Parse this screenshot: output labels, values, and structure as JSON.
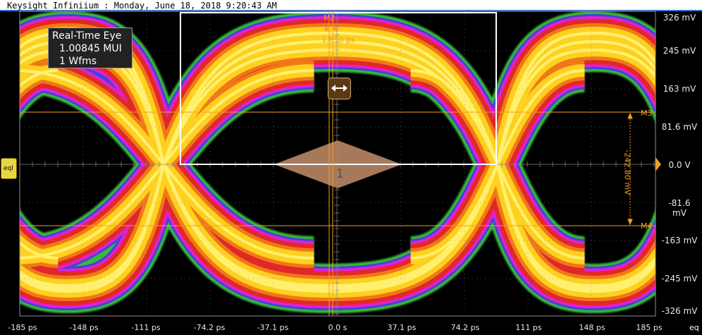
{
  "window": {
    "title": "Keysight Infiniium : Monday, June 18, 2018 9:20:43 AM"
  },
  "info_box": {
    "title": "Real-Time Eye",
    "mui": "1.00845 MUI",
    "wfms": "1 Wfms"
  },
  "y_axis": {
    "labels": [
      "326 mV",
      "245 mV",
      "163 mV",
      "81.6 mV",
      "0.0 V",
      "-81.6 mV",
      "-163 mV",
      "-245 mV",
      "-326 mV"
    ]
  },
  "x_axis": {
    "labels": [
      "-185 ps",
      "-148 ps",
      "-111 ps",
      "-74.2 ps",
      "-37.1 ps",
      "0.0 s",
      "37.1 ps",
      "74.2 ps",
      "111 ps",
      "148 ps",
      "185 ps"
    ]
  },
  "markers": {
    "m2_label": "M2",
    "m2_value": "1.850 ps",
    "m3_label": "M3",
    "m4_label": "M4",
    "delta_v": "-242.80 mV",
    "mask_label": "1"
  },
  "buttons": {
    "left_eql": "eql",
    "right_eq": "eq"
  },
  "colors": {
    "grid": "#8a8a8a",
    "marker": "#f0a020",
    "mask": "#b08060",
    "title_underline": "#3a6fd0"
  }
}
